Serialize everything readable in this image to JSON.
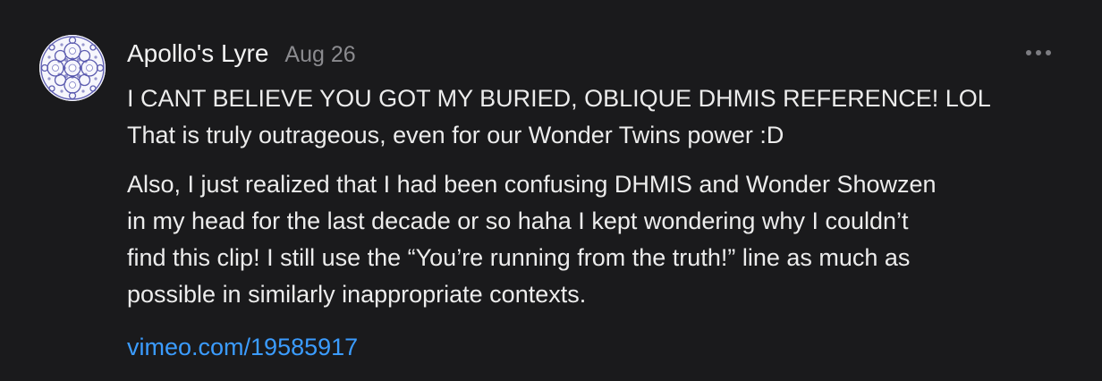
{
  "comment": {
    "author": "Apollo's Lyre",
    "date": "Aug 26",
    "avatar_icon": "fractal-circle-avatar-icon",
    "more_icon": "more-horizontal-icon",
    "paragraphs": [
      "I CANT BELIEVE YOU GOT MY BURIED, OBLIQUE DHMIS REFERENCE! LOL\nThat is truly outrageous, even for our Wonder Twins power :D",
      "Also, I just realized that I had been confusing DHMIS and Wonder Showzen\nin my head for the last decade or so haha I kept wondering why I couldn’t\nfind this clip! I still use the “You’re running from the truth!” line as much as\npossible in similarly inappropriate contexts."
    ],
    "link": "vimeo.com/19585917"
  },
  "colors": {
    "background": "#1a1a1c",
    "text": "#ececec",
    "muted": "#8b8b8f",
    "link": "#3b9cff"
  }
}
